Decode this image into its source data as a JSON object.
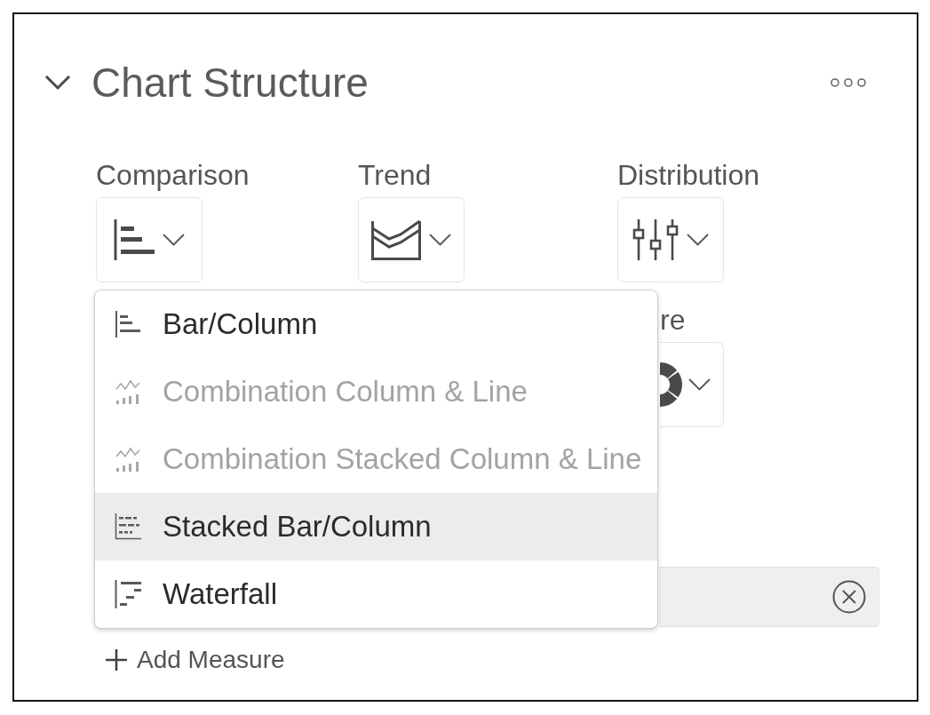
{
  "panel": {
    "title": "Chart Structure",
    "expanded": true
  },
  "categories": [
    {
      "label": "Comparison"
    },
    {
      "label": "Trend"
    },
    {
      "label": "Distribution"
    }
  ],
  "covered_category": {
    "label": "re"
  },
  "comparison_menu": {
    "items": [
      {
        "label": "Bar/Column",
        "disabled": false,
        "selected": false
      },
      {
        "label": "Combination Column & Line",
        "disabled": true,
        "selected": false
      },
      {
        "label": "Combination Stacked Column & Line",
        "disabled": true,
        "selected": false
      },
      {
        "label": "Stacked Bar/Column",
        "disabled": false,
        "selected": true
      },
      {
        "label": "Waterfall",
        "disabled": false,
        "selected": false
      }
    ]
  },
  "measure_token": {
    "removable": true
  },
  "add_measure": {
    "label": "Add Measure"
  }
}
